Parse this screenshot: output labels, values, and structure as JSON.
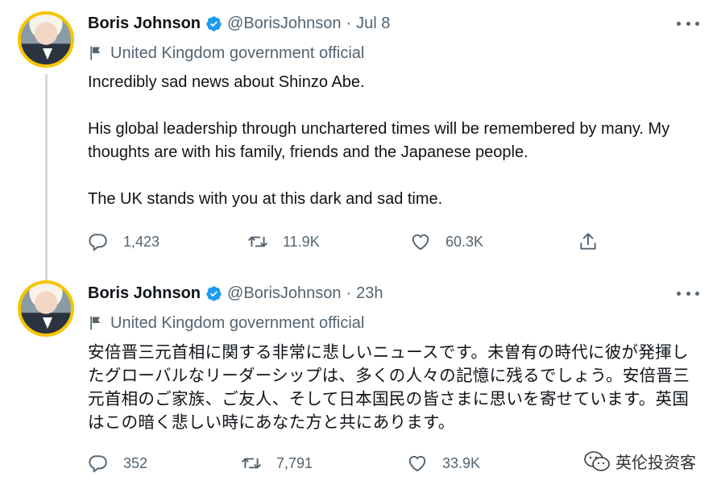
{
  "tweets": [
    {
      "author": "Boris Johnson",
      "handle": "@BorisJohnson",
      "separator": "·",
      "time": "Jul 8",
      "label": "United Kingdom government official",
      "paragraphs": [
        "Incredibly sad news about Shinzo Abe.",
        "His global leadership through unchartered times will be remembered by many. My thoughts are with his family, friends and the Japanese people.",
        "The UK stands with you at this dark and sad time."
      ],
      "replies": "1,423",
      "retweets": "11.9K",
      "likes": "60.3K"
    },
    {
      "author": "Boris Johnson",
      "handle": "@BorisJohnson",
      "separator": "·",
      "time": "23h",
      "label": "United Kingdom government official",
      "paragraphs": [
        "安倍晋三元首相に関する非常に悲しいニュースです。未曽有の時代に彼が発揮したグローバルなリーダーシップは、多くの人々の記憶に残るでしょう。安倍晋三元首相のご家族、ご友人、そして日本国民の皆さまに思いを寄せています。英国はこの暗く悲しい時にあなた方と共にあります。"
      ],
      "replies": "352",
      "retweets": "7,791",
      "likes": "33.9K"
    }
  ],
  "watermark": "英伦投资客",
  "colors": {
    "text": "#0f1419",
    "secondary": "#536471",
    "verified": "#1d9bf0",
    "avatar_ring": "#f5c500",
    "thread_line": "#cfd9de"
  },
  "icons": [
    "verified-badge-icon",
    "flag-icon",
    "more-icon",
    "reply-icon",
    "retweet-icon",
    "like-icon",
    "share-icon",
    "wechat-icon"
  ]
}
